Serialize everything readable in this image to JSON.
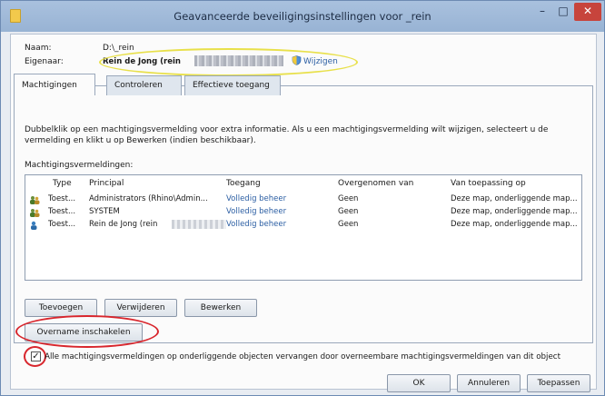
{
  "window": {
    "title": "Geavanceerde beveiligingsinstellingen voor _rein",
    "minimize_glyph": "–",
    "maximize_glyph": "□",
    "close_glyph": "✕"
  },
  "info": {
    "name_label": "Naam:",
    "name_value": "D:\\_rein",
    "owner_label": "Eigenaar:",
    "owner_value": "Rein de Jong (rein",
    "change_link": "Wijzigen"
  },
  "tabs": [
    {
      "label": "Machtigingen",
      "active": true
    },
    {
      "label": "Controleren",
      "active": false
    },
    {
      "label": "Effectieve toegang",
      "active": false
    }
  ],
  "instructions": "Dubbelklik op een machtigingsvermelding voor extra informatie. Als u een machtigingsvermelding wilt wijzigen, selecteert u de vermelding en klikt u op Bewerken (indien beschikbaar).",
  "list_label": "Machtigingsvermeldingen:",
  "table": {
    "headers": [
      "Type",
      "Principal",
      "Toegang",
      "Overgenomen van",
      "Van toepassing op"
    ],
    "rows": [
      {
        "type": "Toest...",
        "principal": "Administrators (Rhino\\Admin...",
        "access": "Volledig beheer",
        "inherited": "Geen",
        "applies": "Deze map, onderliggende map..."
      },
      {
        "type": "Toest...",
        "principal": "SYSTEM",
        "access": "Volledig beheer",
        "inherited": "Geen",
        "applies": "Deze map, onderliggende map..."
      },
      {
        "type": "Toest...",
        "principal": "Rein de Jong (rein",
        "access": "Volledig beheer",
        "inherited": "Geen",
        "applies": "Deze map, onderliggende map..."
      }
    ]
  },
  "buttons": {
    "add": "Toevoegen",
    "remove": "Verwijderen",
    "edit": "Bewerken",
    "enable_inheritance": "Overname inschakelen",
    "ok": "OK",
    "cancel": "Annuleren",
    "apply": "Toepassen"
  },
  "replace_checkbox": {
    "checked": true,
    "mark": "✓",
    "label": "Alle machtigingsvermeldingen op onderliggende objecten vervangen door overneembare machtigingsvermeldingen van dit object"
  },
  "colors": {
    "highlight_yellow": "#e8e04a",
    "highlight_red": "#d8262d",
    "link_blue": "#2b5ea3"
  }
}
